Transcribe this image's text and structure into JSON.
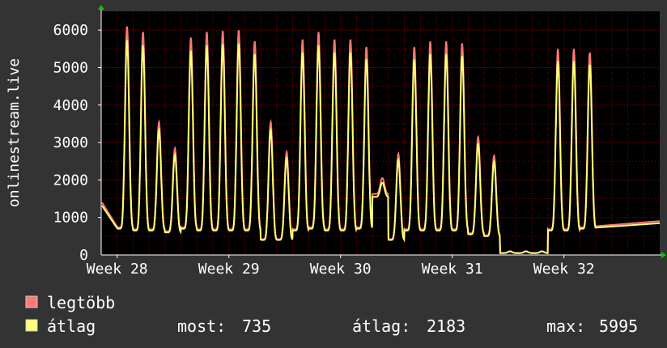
{
  "chart_data": {
    "type": "line",
    "ylabel": "onlinestream.live",
    "ylim": [
      0,
      6500
    ],
    "y_ticks": [
      "0",
      "1000",
      "2000",
      "3000",
      "4000",
      "5000",
      "6000"
    ],
    "x_ticks": [
      "Week 28",
      "Week 29",
      "Week 30",
      "Week 31",
      "Week 32"
    ],
    "grid": true,
    "x_start_day": 0,
    "x_end_day": 35,
    "x_tick_days": [
      1,
      8,
      15,
      22,
      29
    ],
    "daily_peaks": [
      6100,
      5950,
      3550,
      2850,
      5800,
      5950,
      5980,
      6000,
      5700,
      3550,
      2750,
      5750,
      5950,
      5750,
      5750,
      5550,
      2050,
      2700,
      5550,
      5700,
      5700,
      5650,
      3150,
      2650,
      100,
      100,
      100,
      5500,
      5500,
      5400
    ],
    "daily_troughs": [
      700,
      650,
      650,
      600,
      700,
      650,
      650,
      650,
      650,
      400,
      400,
      650,
      700,
      650,
      650,
      700,
      1550,
      400,
      650,
      650,
      650,
      650,
      550,
      500,
      50,
      50,
      50,
      650,
      650,
      700
    ],
    "series": [
      {
        "name": "legtöbb",
        "color": "#ff7777"
      },
      {
        "name": "átlag",
        "color": "#ffff77"
      }
    ],
    "legend": {
      "max_label": "legtöbb",
      "avg_label": "átlag",
      "stats": [
        {
          "label": "most:",
          "value": "735"
        },
        {
          "label": "átlag:",
          "value": "2183"
        },
        {
          "label": "max:",
          "value": "5995"
        }
      ]
    }
  },
  "colors": {
    "background": "#333333",
    "plot_background": "#000000",
    "grid": "#800000",
    "axis": "#ffffff",
    "arrow": "#00cc00",
    "max_line": "#ff7777",
    "avg_line": "#ffff77"
  }
}
